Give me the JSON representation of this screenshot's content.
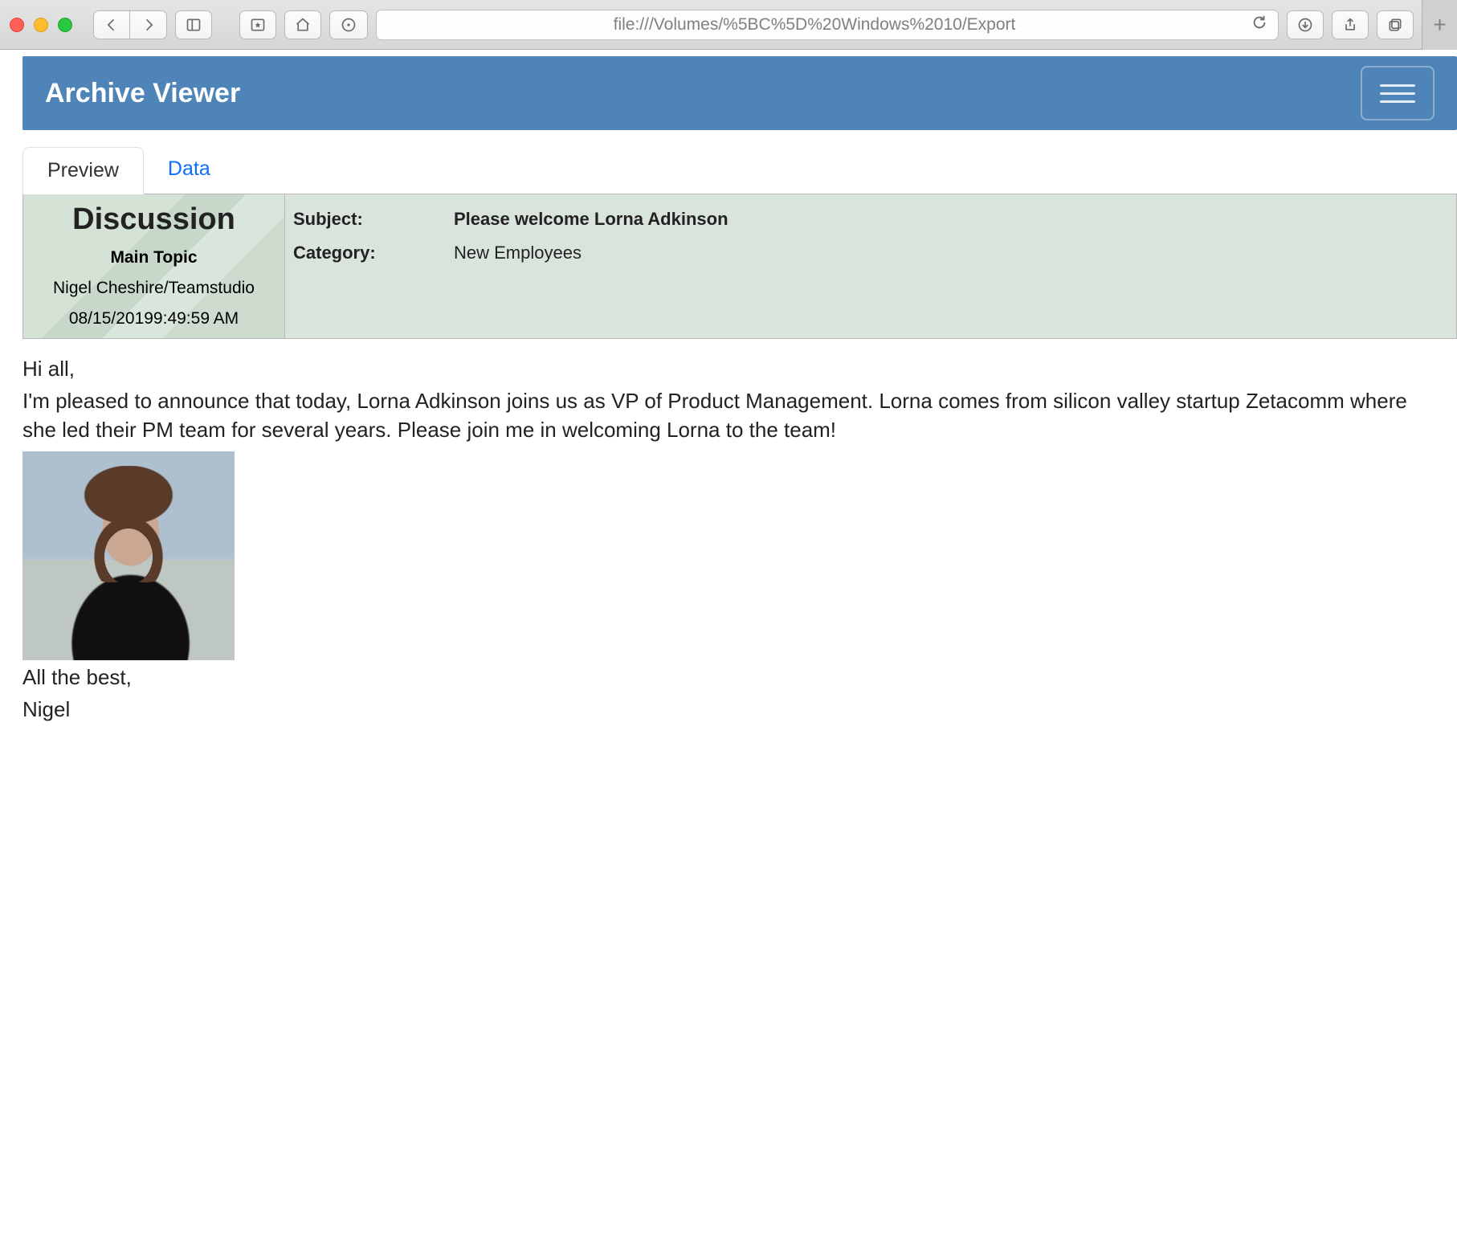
{
  "browser": {
    "url": "file:///Volumes/%5BC%5D%20Windows%2010/Export"
  },
  "header": {
    "title": "Archive Viewer"
  },
  "tabs": {
    "preview": "Preview",
    "data": "Data"
  },
  "meta": {
    "heading": "Discussion",
    "main_topic_label": "Main Topic",
    "author": "Nigel Cheshire/Teamstudio",
    "timestamp": "08/15/20199:49:59 AM",
    "subject_label": "Subject:",
    "subject_value": "Please welcome Lorna Adkinson",
    "category_label": "Category:",
    "category_value": "New Employees"
  },
  "body": {
    "p1": "Hi all,",
    "p2": "I'm pleased to announce that today, Lorna Adkinson joins us as VP of Product Management. Lorna comes from silicon valley startup Zetacomm where she led their PM team for several years. Please join me in welcoming Lorna to the team!",
    "p3": "All the best,",
    "p4": "Nigel"
  }
}
